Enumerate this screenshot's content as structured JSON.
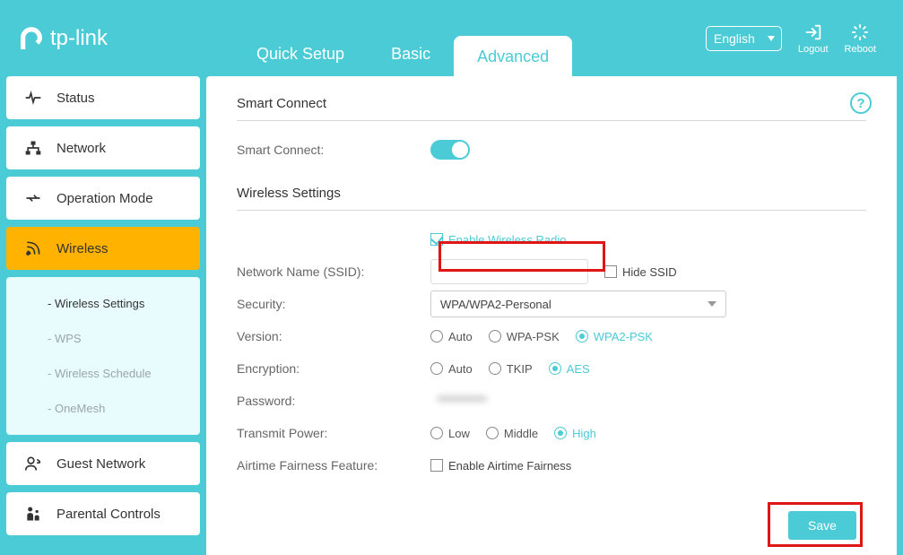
{
  "brand": "tp-link",
  "tabs": {
    "quick": "Quick Setup",
    "basic": "Basic",
    "advanced": "Advanced"
  },
  "lang": "English",
  "top": {
    "logout": "Logout",
    "reboot": "Reboot"
  },
  "sidebar": {
    "status": "Status",
    "network": "Network",
    "opmode": "Operation Mode",
    "wireless": "Wireless",
    "sub": {
      "wsettings": "Wireless Settings",
      "wps": "WPS",
      "wsched": "Wireless Schedule",
      "onemesh": "OneMesh"
    },
    "guest": "Guest Network",
    "parental": "Parental Controls"
  },
  "sections": {
    "smart": "Smart Connect",
    "wireless": "Wireless Settings"
  },
  "labels": {
    "smartconnect": "Smart Connect:",
    "enable_radio": "Enable Wireless Radio",
    "ssid": "Network Name (SSID):",
    "hide": "Hide SSID",
    "security": "Security:",
    "version": "Version:",
    "encryption": "Encryption:",
    "password": "Password:",
    "txpower": "Transmit Power:",
    "airtime": "Airtime Fairness Feature:",
    "airtime_chk": "Enable Airtime Fairness"
  },
  "values": {
    "ssid": "",
    "security": "WPA/WPA2-Personal",
    "password": "••••••••••••"
  },
  "radios": {
    "version": {
      "auto": "Auto",
      "wpa": "WPA-PSK",
      "wpa2": "WPA2-PSK"
    },
    "encryption": {
      "auto": "Auto",
      "tkip": "TKIP",
      "aes": "AES"
    },
    "txpower": {
      "low": "Low",
      "mid": "Middle",
      "high": "High"
    }
  },
  "buttons": {
    "save": "Save"
  },
  "help": "?"
}
